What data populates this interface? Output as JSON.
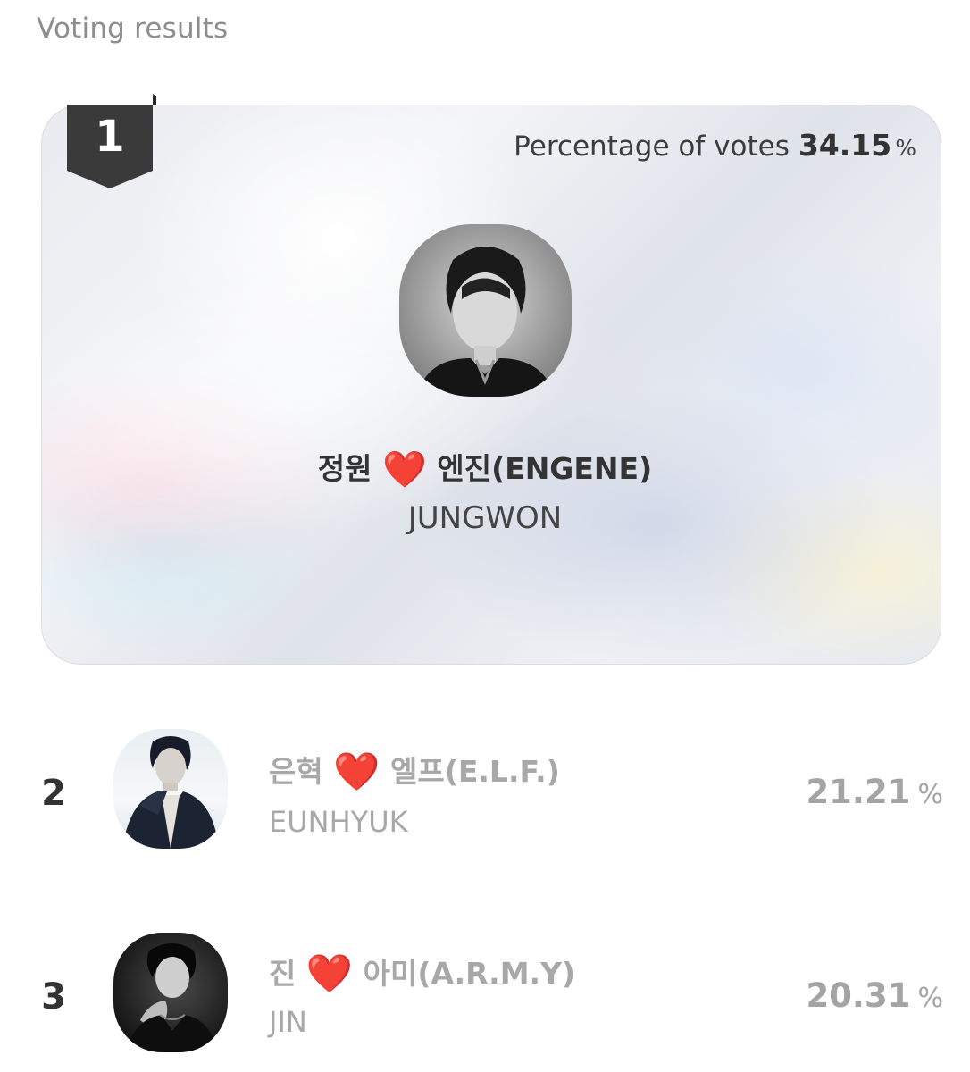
{
  "header": {
    "title": "Voting results"
  },
  "winner": {
    "rank": "1",
    "votes_label": "Percentage of votes",
    "votes_value": "34.15",
    "votes_unit": "%",
    "name_ko_first": "정원",
    "heart": "❤️",
    "name_ko_second": "엔진(ENGENE)",
    "name_en": "JUNGWON"
  },
  "ranking": [
    {
      "rank": "2",
      "name_ko_first": "은혁",
      "heart": "❤️",
      "name_ko_second": "엘프(E.L.F.)",
      "name_en": "EUNHYUK",
      "pct_value": "21.21",
      "pct_unit": "%"
    },
    {
      "rank": "3",
      "name_ko_first": "진",
      "heart": "❤️",
      "name_ko_second": "아미(A.R.M.Y)",
      "name_en": "JIN",
      "pct_value": "20.31",
      "pct_unit": "%"
    }
  ],
  "colors": {
    "heart": "#e0102a",
    "badge": "#3a3a3a",
    "muted_text": "#a8a8a8"
  },
  "icons": [
    "rank-ribbon-icon",
    "heart-icon"
  ]
}
